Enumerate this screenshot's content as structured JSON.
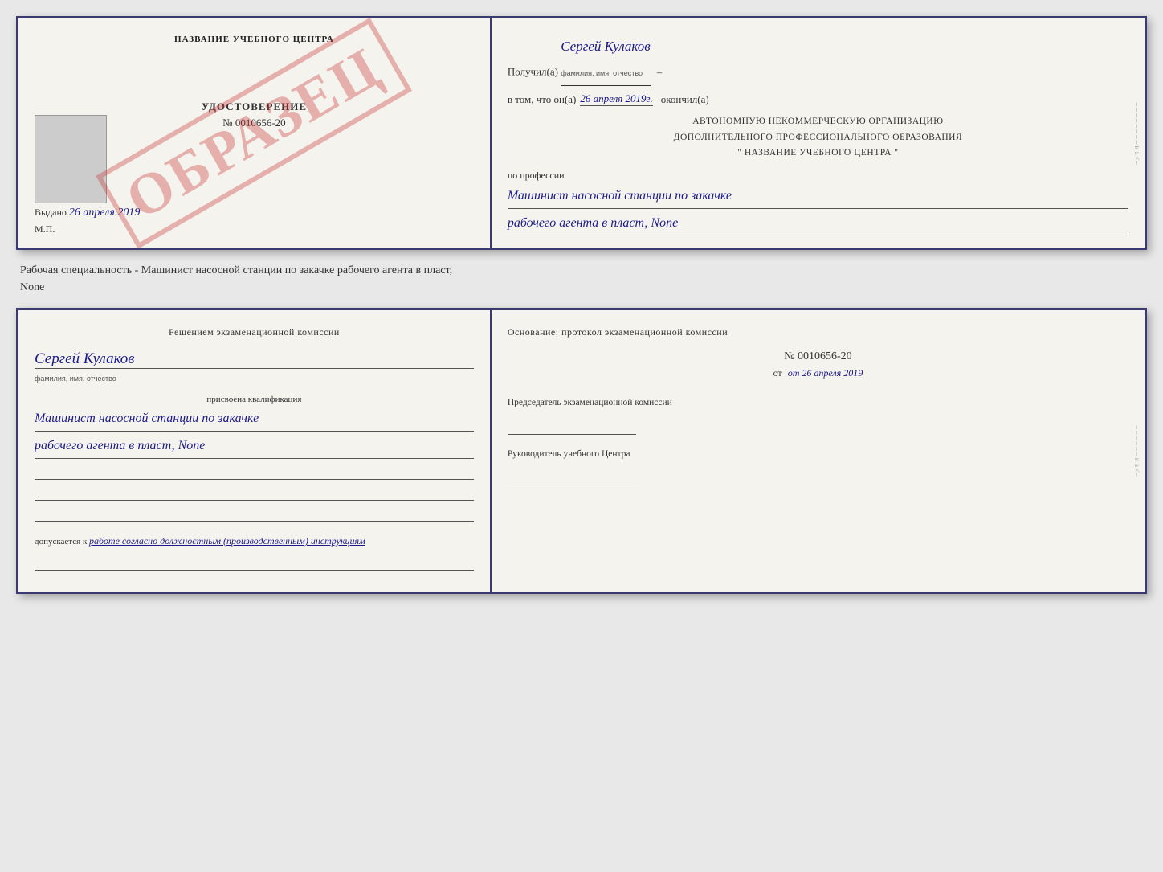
{
  "topDoc": {
    "left": {
      "centerTitle": "НАЗВАНИЕ УЧЕБНОГО ЦЕНТРА",
      "obrazec": "ОБРАЗЕЦ",
      "udostovereniLabel": "УДОСТОВЕРЕНИЕ",
      "number": "№ 0010656-20",
      "vydano": "Выдано",
      "vydanoDate": "26 апреля 2019",
      "mp": "М.П."
    },
    "right": {
      "recipientLabel": "Получил(а)",
      "recipientName": "Сергей Кулаков",
      "recipientHint": "фамилия, имя, отчество",
      "dateLabel": "в том, что он(а)",
      "dateValue": "26 апреля 2019г.",
      "dateEnd": "окончил(а)",
      "orgLine1": "АВТОНОМНУЮ НЕКОММЕРЧЕСКУЮ ОРГАНИЗАЦИЮ",
      "orgLine2": "ДОПОЛНИТЕЛЬНОГО ПРОФЕССИОНАЛЬНОГО ОБРАЗОВАНИЯ",
      "orgLine3": "\" НАЗВАНИЕ УЧЕБНОГО ЦЕНТРА \"",
      "professionLabel": "по профессии",
      "professionLine1": "Машинист насосной станции по закачке",
      "professionLine2": "рабочего агента в пласт, None"
    }
  },
  "betweenText": {
    "line1": "Рабочая специальность - Машинист насосной станции по закачке рабочего агента в пласт,",
    "line2": "None"
  },
  "bottomDoc": {
    "left": {
      "commissionTitle": "Решением экзаменационной комиссии",
      "personName": "Сергей Кулаков",
      "personHint": "фамилия, имя, отчество",
      "qualificationLabel": "присвоена квалификация",
      "qualLine1": "Машинист насосной станции по закачке",
      "qualLine2": "рабочего агента в пласт, None",
      "dopuskaetsya": "допускается к",
      "dopuskaetsyaItalic": "работе согласно должностным (производственным) инструкциям"
    },
    "right": {
      "osnovaniTitle": "Основание: протокол экзаменационной комиссии",
      "protocolNumber": "№ 0010656-20",
      "protocolDate": "от 26 апреля 2019",
      "chairmanLabel": "Председатель экзаменационной комиссии",
      "headLabel": "Руководитель учебного Центра"
    }
  }
}
